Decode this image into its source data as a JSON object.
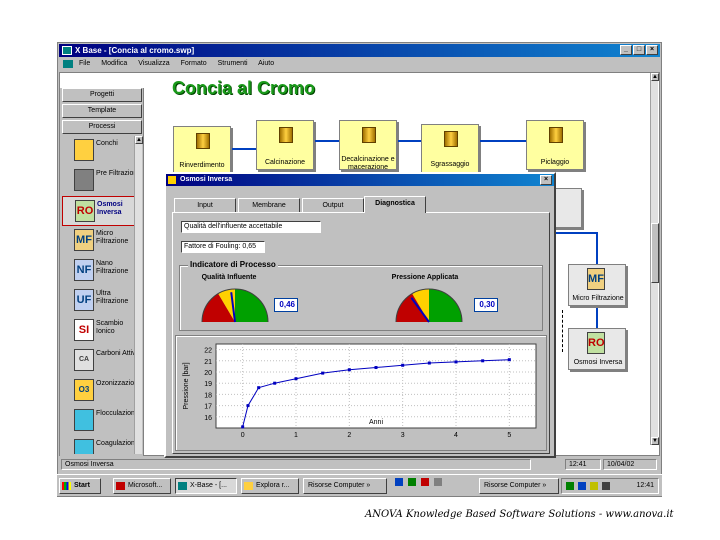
{
  "window": {
    "title": "X Base - [Concia al cromo.swp]",
    "controls": [
      "_",
      "□",
      "×"
    ]
  },
  "menu": [
    "File",
    "Modifica",
    "Visualizza",
    "Formato",
    "Strumenti",
    "Aiuto"
  ],
  "left_panel": {
    "tabs": [
      "Progetti",
      "Template",
      "Processi"
    ],
    "items": [
      {
        "icon": "",
        "label": "Conchi"
      },
      {
        "icon": "",
        "label": "Pre Filtrazione"
      },
      {
        "icon": "RO",
        "label": "Osmosi Inversa"
      },
      {
        "icon": "MF",
        "label": "Micro Filtrazione"
      },
      {
        "icon": "NF",
        "label": "Nano Filtrazione"
      },
      {
        "icon": "UF",
        "label": "Ultra Filtrazione"
      },
      {
        "icon": "SI",
        "label": "Scambio Ionico"
      },
      {
        "icon": "CA",
        "label": "Carboni Attivi"
      },
      {
        "icon": "O3",
        "label": "Ozonizzazione"
      },
      {
        "icon": "",
        "label": "Flocculazione"
      },
      {
        "icon": "",
        "label": "Coagulazione"
      }
    ]
  },
  "canvas": {
    "title": "Concia al Cromo",
    "processes": [
      "Rinverdimento",
      "Calcinazione",
      "Decalcinazione e macerazione",
      "Sgrassaggio",
      "Piclaggio"
    ],
    "side_boxes": [
      "Micro Filtrazione",
      "Osmosi Inversa"
    ],
    "side_box_icons": [
      "MF",
      "RO"
    ]
  },
  "dialog": {
    "title": "Osmosi Inversa",
    "close": "×",
    "tabs": [
      "Input",
      "Membrane",
      "Output",
      "Diagnostica"
    ],
    "fields": [
      "Qualità dell'influente accettabile",
      "Fattore di Fouling: 0,65"
    ],
    "group_title": "Indicatore di Processo",
    "gauges": [
      {
        "label": "Qualità Influente",
        "value": "0,46",
        "level": 0.46
      },
      {
        "label": "Pressione Applicata",
        "value": "0,30",
        "level": 0.3
      }
    ]
  },
  "chart_data": {
    "type": "line",
    "x": [
      0,
      0.1,
      0.3,
      0.6,
      1,
      1.5,
      2,
      2.5,
      3,
      3.5,
      4,
      4.5,
      5
    ],
    "series": [
      {
        "values": [
          15.1,
          17.0,
          18.6,
          19.0,
          19.4,
          19.9,
          20.2,
          20.4,
          20.6,
          20.8,
          20.9,
          21.0,
          21.1
        ]
      }
    ],
    "xlabel": "Anni",
    "ylabel": "Pressione [bar]",
    "xticks": [
      "0",
      "1",
      "2",
      "3",
      "4",
      "5"
    ],
    "yticks": [
      "22",
      "21",
      "20",
      "19",
      "18",
      "17",
      "16"
    ],
    "xlim": [
      -0.5,
      5.5
    ],
    "ylim": [
      15,
      22.5
    ],
    "grid": true,
    "line_color": "#0000c0"
  },
  "statusbar": {
    "left": "Osmosi Inversa",
    "time": "12:41",
    "date": "10/04/02"
  },
  "taskbar": {
    "start": "Start",
    "buttons": [
      "Microsoft...",
      "X-Base - [...",
      "Explora r...",
      "Risorse Computer »",
      "Risorse Computer »"
    ],
    "clock": "12:41"
  },
  "footer": "ANOVA Knowledge Based Software Solutions - www.anova.it",
  "colors": {
    "title_green": "#1a9a1a",
    "titlebar": "#000080",
    "flow": "#0040c0"
  }
}
